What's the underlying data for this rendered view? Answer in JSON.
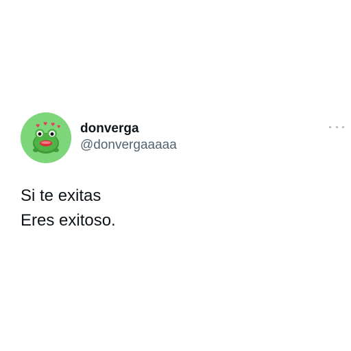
{
  "tweet": {
    "author": {
      "display_name": "donverga",
      "handle": "@donvergaaaaa",
      "avatar_icon": "frog-avatar-icon",
      "avatar_bg": "#7ed67a"
    },
    "menu_icon": "more-options-icon",
    "text_lines": [
      "Si te exitas",
      "Eres exitoso."
    ]
  }
}
